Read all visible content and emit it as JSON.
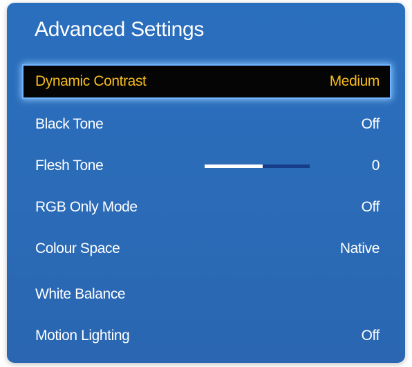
{
  "menu": {
    "title": "Advanced Settings",
    "items": [
      {
        "label": "Dynamic Contrast",
        "value": "Medium",
        "selected": true
      },
      {
        "label": "Black Tone",
        "value": "Off"
      },
      {
        "label": "Flesh Tone",
        "value": "0",
        "slider_level": 0.55
      },
      {
        "label": "RGB Only Mode",
        "value": "Off"
      },
      {
        "label": "Colour Space",
        "value": "Native"
      },
      {
        "label": "White Balance",
        "value": ""
      },
      {
        "label": "Motion Lighting",
        "value": "Off"
      }
    ]
  },
  "colors": {
    "panel_blue": "#2a6cb8",
    "highlight_bg": "#050505",
    "highlight_text": "#f7bc1c",
    "highlight_glow": "#6fb2ff",
    "slider_track": "#153d88",
    "slider_fill": "#ffffff"
  }
}
